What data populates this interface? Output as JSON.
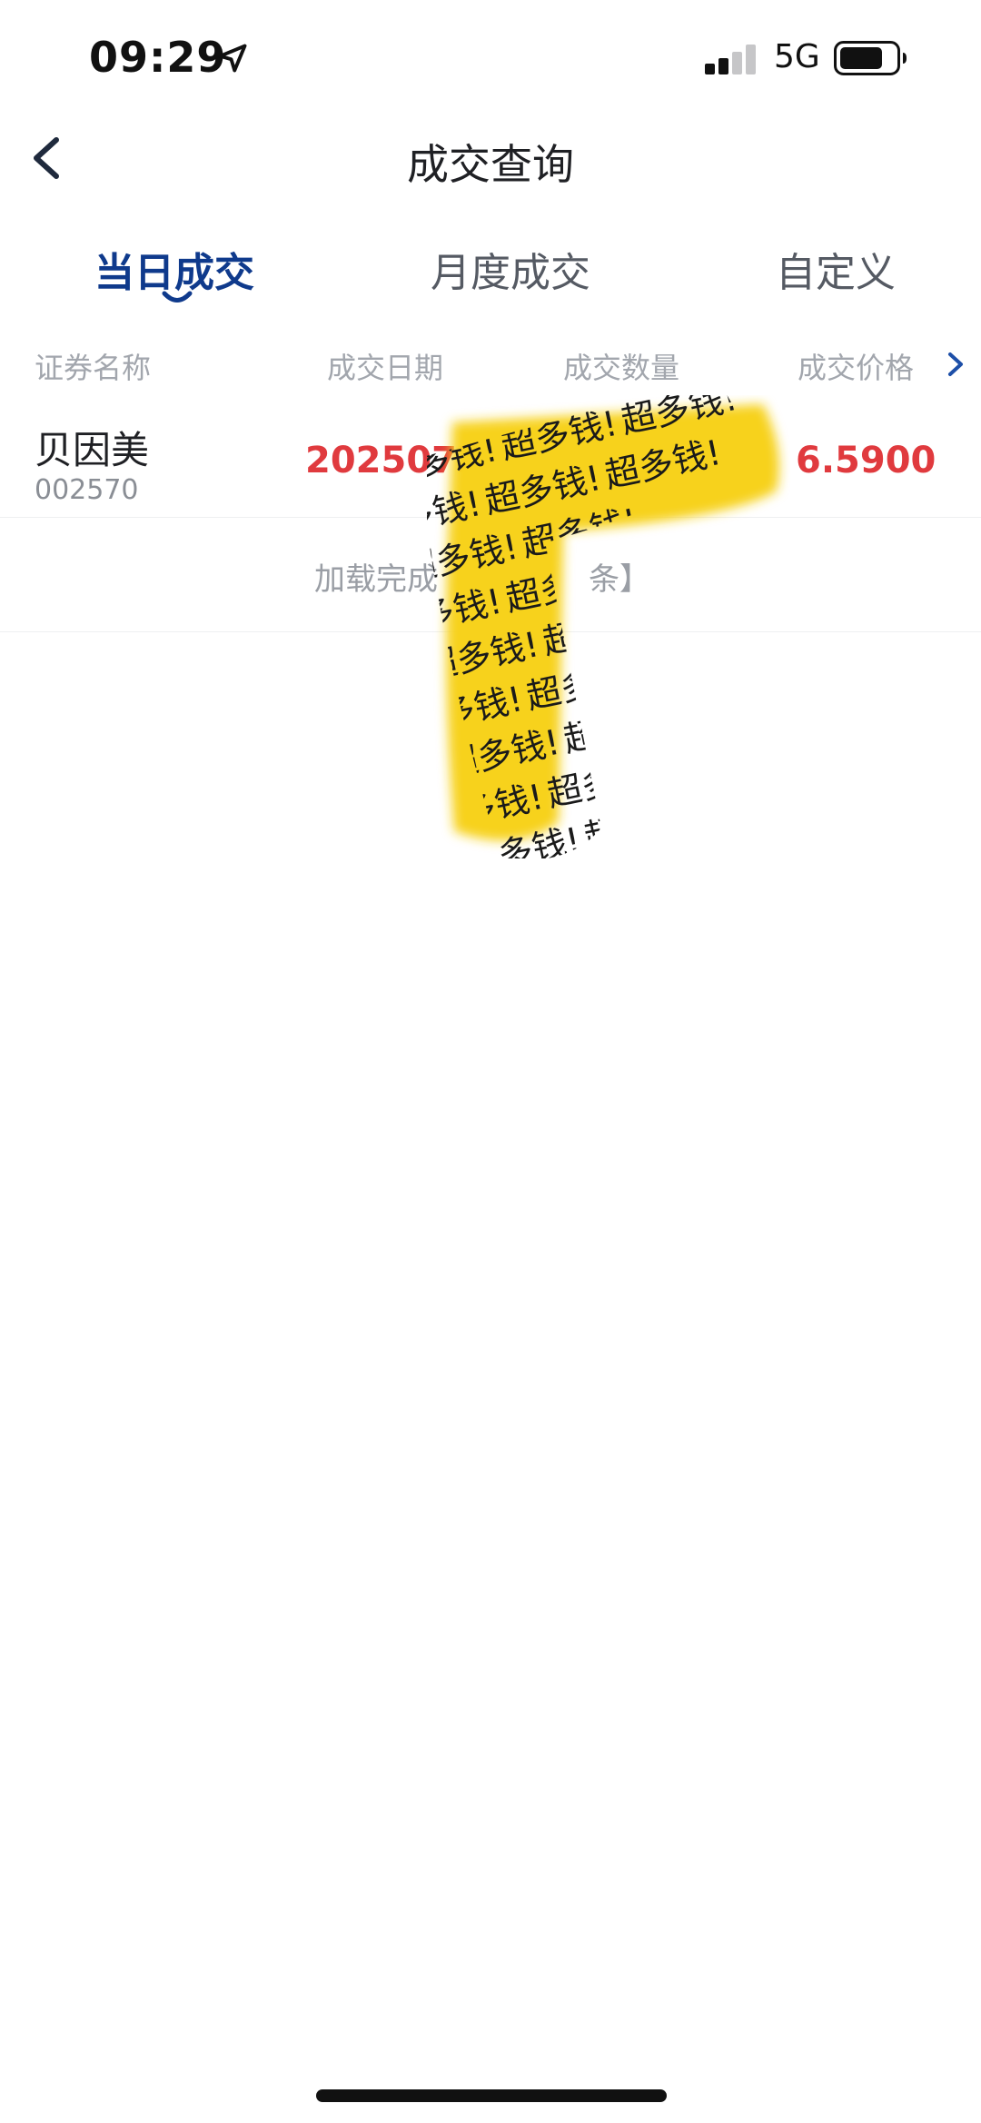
{
  "status_bar": {
    "time": "09:29",
    "network": "5G",
    "icons": [
      "location-arrow-icon",
      "signal-icon",
      "battery-icon"
    ]
  },
  "nav": {
    "back_icon": "chevron-left-icon",
    "title": "成交查询"
  },
  "tabs": [
    {
      "label": "当日成交",
      "active": true
    },
    {
      "label": "月度成交",
      "active": false
    },
    {
      "label": "自定义",
      "active": false
    }
  ],
  "columns": [
    "证券名称",
    "成交日期",
    "成交数量",
    "成交价格"
  ],
  "more_columns_icon": "chevron-right-icon",
  "rows": [
    {
      "name": "贝因美",
      "code": "002570",
      "date": "20250730",
      "price": "6.5900"
    }
  ],
  "load_status": {
    "text": "加载完成",
    "suffix": "条】"
  },
  "sticker_text": "超多钱!",
  "colors": {
    "accent": "#0f3a8c",
    "rise": "#e03a3e",
    "sticker": "#f7d21a"
  }
}
